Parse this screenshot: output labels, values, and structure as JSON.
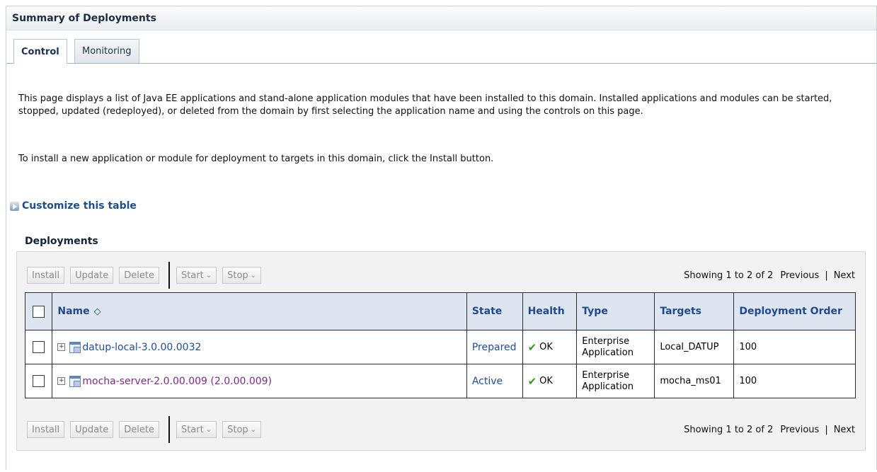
{
  "title": "Summary of Deployments",
  "tabs": [
    {
      "label": "Control",
      "active": true
    },
    {
      "label": "Monitoring",
      "active": false
    }
  ],
  "intro": {
    "p1": "This page displays a list of Java EE applications and stand-alone application modules that have been installed to this domain. Installed applications and modules can be started, stopped, updated (redeployed), or deleted from the domain by first selecting the application name and using the controls on this page.",
    "p2": "To install a new application or module for deployment to targets in this domain, click the Install button."
  },
  "customize_link": "Customize this table",
  "deployments_heading": "Deployments",
  "toolbar": {
    "install": "Install",
    "update": "Update",
    "delete": "Delete",
    "start": "Start",
    "stop": "Stop",
    "dropdown_icon": "chevron-down-icon"
  },
  "pager": {
    "showing": "Showing 1 to 2 of 2",
    "previous": "Previous",
    "separator": "|",
    "next": "Next"
  },
  "table": {
    "headers": {
      "name": "Name",
      "state": "State",
      "health": "Health",
      "type": "Type",
      "targets": "Targets",
      "order": "Deployment Order"
    },
    "sort_icon": "sort-ascending-icon",
    "rows": [
      {
        "name": "datup-local-3.0.00.0032",
        "state": "Prepared",
        "health": "OK",
        "type_line1": "Enterprise",
        "type_line2": "Application",
        "targets": "Local_DATUP",
        "order": "100"
      },
      {
        "name": "mocha-server-2.0.00.009 (2.0.00.009)",
        "state": "Active",
        "health": "OK",
        "type_line1": "Enterprise",
        "type_line2": "Application",
        "targets": "mocha_ms01",
        "order": "100"
      }
    ]
  },
  "colors": {
    "link": "#1f4e9a",
    "visited_link": "#7d2a87",
    "header_bg": "#dce5f0",
    "ok_check": "#2f9b1b"
  }
}
